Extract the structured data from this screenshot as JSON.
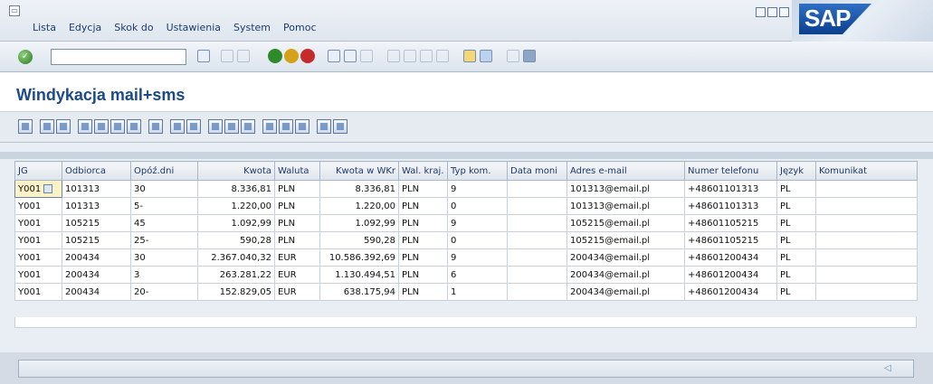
{
  "window": {
    "menu": [
      "Lista",
      "Edycja",
      "Skok do",
      "Ustawienia",
      "System",
      "Pomoc"
    ],
    "logo_text": "SAP"
  },
  "toolbar": {
    "command_field_value": "",
    "command_field_placeholder": ""
  },
  "title": "Windykacja mail+sms",
  "grid": {
    "columns": [
      "JG",
      "Odbiorca",
      "Opóź.dni",
      "Kwota",
      "Waluta",
      "Kwota w WKr",
      "Wal. kraj.",
      "Typ kom.",
      "Data moni",
      "Adres e-mail",
      "Numer telefonu",
      "Język",
      "Komunikat"
    ],
    "rows": [
      [
        "Y001",
        "101313",
        "30",
        "8.336,81",
        "PLN",
        "8.336,81",
        "PLN",
        "9",
        "",
        "101313@email.pl",
        "+48601101313",
        "PL",
        ""
      ],
      [
        "Y001",
        "101313",
        "5-",
        "1.220,00",
        "PLN",
        "1.220,00",
        "PLN",
        "0",
        "",
        "101313@email.pl",
        "+48601101313",
        "PL",
        ""
      ],
      [
        "Y001",
        "105215",
        "45",
        "1.092,99",
        "PLN",
        "1.092,99",
        "PLN",
        "9",
        "",
        "105215@email.pl",
        "+48601105215",
        "PL",
        ""
      ],
      [
        "Y001",
        "105215",
        "25-",
        "590,28",
        "PLN",
        "590,28",
        "PLN",
        "0",
        "",
        "105215@email.pl",
        "+48601105215",
        "PL",
        ""
      ],
      [
        "Y001",
        "200434",
        "30",
        "2.367.040,32",
        "EUR",
        "10.586.392,69",
        "PLN",
        "9",
        "",
        "200434@email.pl",
        "+48601200434",
        "PL",
        ""
      ],
      [
        "Y001",
        "200434",
        "3",
        "263.281,22",
        "EUR",
        "1.130.494,51",
        "PLN",
        "6",
        "",
        "200434@email.pl",
        "+48601200434",
        "PL",
        ""
      ],
      [
        "Y001",
        "200434",
        "20-",
        "152.829,05",
        "EUR",
        "638.175,94",
        "PLN",
        "1",
        "",
        "200434@email.pl",
        "+48601200434",
        "PL",
        ""
      ]
    ]
  },
  "status": {
    "text": ""
  },
  "colors": {
    "title": "#1b4a8c",
    "selected_cell": "#fbf2c8",
    "frame": "#d4dbe4"
  }
}
